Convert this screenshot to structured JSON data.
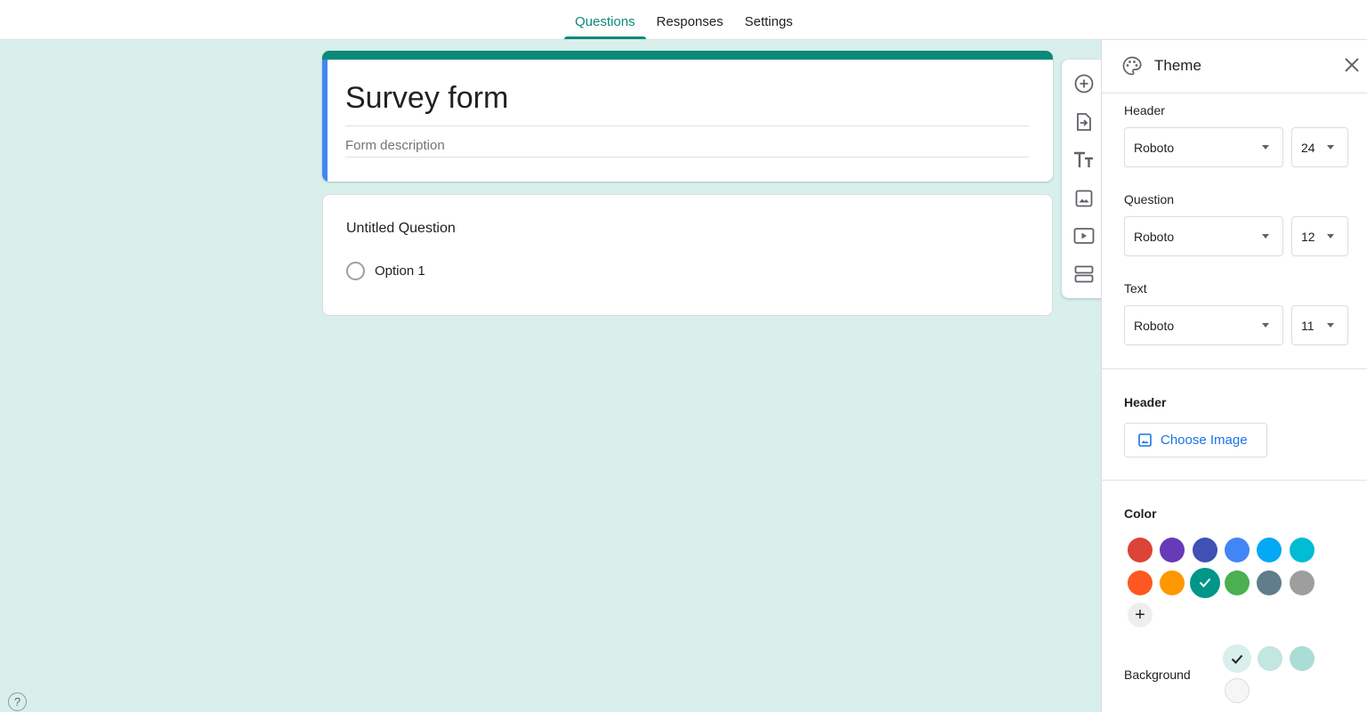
{
  "tabs": [
    {
      "label": "Questions",
      "active": true
    },
    {
      "label": "Responses",
      "active": false
    },
    {
      "label": "Settings",
      "active": false
    }
  ],
  "form": {
    "title": "Survey form",
    "description_placeholder": "Form description",
    "accent_color": "#0b8a7a",
    "focus_color": "#4285f4"
  },
  "question": {
    "title": "Untitled Question",
    "options": [
      "Option 1"
    ]
  },
  "toolbar": {
    "icons": [
      "add-question-icon",
      "import-questions-icon",
      "add-title-icon",
      "add-image-icon",
      "add-video-icon",
      "add-section-icon"
    ]
  },
  "theme_panel": {
    "title": "Theme",
    "text_style": {
      "header_label": "Header",
      "header_font": "Roboto",
      "header_size": "24",
      "question_label": "Question",
      "question_font": "Roboto",
      "question_size": "12",
      "text_label": "Text",
      "text_font": "Roboto",
      "text_size": "11"
    },
    "header_image": {
      "label": "Header",
      "button_label": "Choose Image"
    },
    "color": {
      "label": "Color",
      "swatches": [
        "#db4437",
        "#673ab7",
        "#3f51b5",
        "#4285f4",
        "#03a9f4",
        "#00bcd4",
        "#ff5722",
        "#ff9800",
        "#009688",
        "#4caf50",
        "#607d8b",
        "#9e9e9e"
      ],
      "selected": "#009688"
    },
    "background": {
      "label": "Background",
      "swatches": [
        "#d8efec",
        "#c2e6e1",
        "#a9ddd6",
        "#f6f6f6"
      ],
      "selected": "#d8efec"
    }
  },
  "help": {
    "icon": "help-icon",
    "glyph": "?"
  }
}
